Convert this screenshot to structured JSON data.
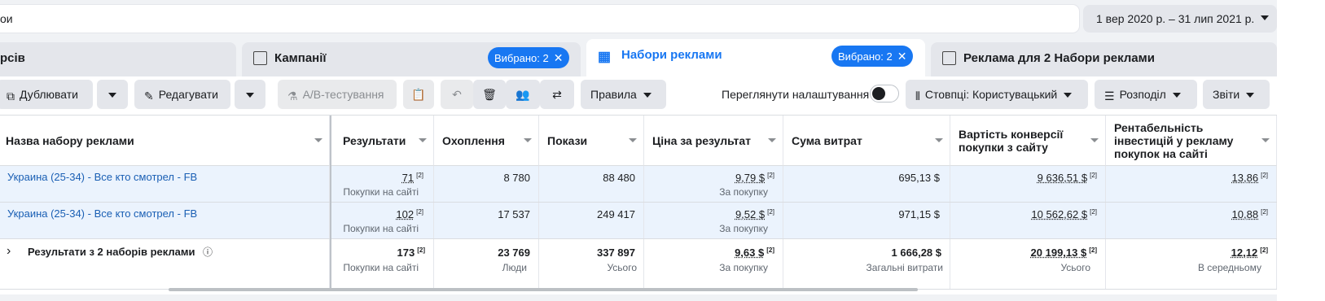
{
  "search": {
    "value": "ои"
  },
  "date_range": {
    "label": "1 вер 2020 р. – 31 лип 2021 р."
  },
  "tabs": [
    {
      "label": "рсів"
    },
    {
      "label": "Кампанії",
      "chip": "Вибрано: 2"
    },
    {
      "label": "Набори реклами",
      "chip": "Вибрано: 2",
      "active": true
    },
    {
      "label": "Реклама для 2 Набори реклами"
    }
  ],
  "toolbar": {
    "duplicate": "Дублювати",
    "edit": "Редагувати",
    "ab_test": "A/B-тестування",
    "rules": "Правила",
    "preview_settings": "Переглянути налаштування",
    "columns": "Стовпці: Користувацький",
    "breakdown": "Розподіл",
    "reports": "Звіти"
  },
  "columns": {
    "name": "Назва набору реклами",
    "results": "Результати",
    "reach": "Охоплення",
    "impressions": "Покази",
    "cost_per_result": "Ціна за результат",
    "amount_spent": "Сума витрат",
    "conv_value": "Вартість конверсії покупки з сайту",
    "roas": "Рентабельність інвестицій у рекламу покупок на сайті"
  },
  "rows": [
    {
      "name": "Украина (25-34) - Все кто смотрел - FB",
      "results": "71",
      "results_sub": "Покупки на сайті",
      "reach": "8 780",
      "impressions": "88 480",
      "cpr": "9,79 $",
      "cpr_sub": "За покупку",
      "spent": "695,13 $",
      "conv": "9 636,51 $",
      "roas": "13,86"
    },
    {
      "name": "Украина (25-34) - Все кто смотрел - FB",
      "results": "102",
      "results_sub": "Покупки на сайті",
      "reach": "17 537",
      "impressions": "249 417",
      "cpr": "9,52 $",
      "cpr_sub": "За покупку",
      "spent": "971,15 $",
      "conv": "10 562,62 $",
      "roas": "10,88"
    }
  ],
  "total": {
    "label": "Результати з 2 наборів реклами",
    "results": "173",
    "results_sub": "Покупки на сайті",
    "reach": "23 769",
    "reach_sub": "Люди",
    "impressions": "337 897",
    "impressions_sub": "Усього",
    "cpr": "9,63 $",
    "cpr_sub": "За покупку",
    "spent": "1 666,28 $",
    "spent_sub": "Загальні витрати",
    "conv": "20 199,13 $",
    "conv_sub": "Усього",
    "roas": "12,12",
    "roas_sub": "В середньому"
  },
  "footnote": "[2]",
  "colors": {
    "accent": "#1877f2",
    "selected_row": "#ebf3fd",
    "link": "#1a5fb4"
  }
}
